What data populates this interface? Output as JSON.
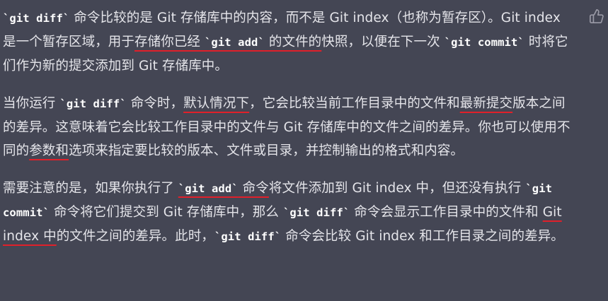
{
  "thumb_icon": "thumbs-up-icon",
  "underline_color": "#e0202a",
  "paragraphs": [
    {
      "segments": [
        {
          "text": "`git diff`",
          "style": "code"
        },
        {
          "text": " 命令比较的是 Git 存储库中的内容，而不是 Git index（也称为暂存区）。Git index 是一个暂存区域，用于",
          "style": "plain"
        },
        {
          "text": "存储你已经 ",
          "style": "underline"
        },
        {
          "text": "`git add`",
          "style": "code-underline"
        },
        {
          "text": " 的文件的",
          "style": "underline"
        },
        {
          "text": "快照，以便在下一次 ",
          "style": "plain"
        },
        {
          "text": "`git commit`",
          "style": "code"
        },
        {
          "text": " 时将它们作为新的提交添加到 Git 存储库中。",
          "style": "plain"
        }
      ]
    },
    {
      "segments": [
        {
          "text": "当你运行 ",
          "style": "plain"
        },
        {
          "text": "`git diff`",
          "style": "code"
        },
        {
          "text": " 命令时，",
          "style": "plain"
        },
        {
          "text": "默认情况下",
          "style": "underline"
        },
        {
          "text": "，它会比较当前工作目录中的文件和",
          "style": "plain"
        },
        {
          "text": "最新提交",
          "style": "underline"
        },
        {
          "text": "版本之间的差异。这意味着它会比较工作目录中的文件与 Git 存储库中的文件之间的差异。你也可以使用不同的",
          "style": "plain"
        },
        {
          "text": "参数和",
          "style": "underline"
        },
        {
          "text": "选项来指定要比较的版本、文件或目录，并控制输出的格式和内容。",
          "style": "plain"
        }
      ]
    },
    {
      "segments": [
        {
          "text": "需要注意的是，如果你执行了 ",
          "style": "plain"
        },
        {
          "text": "`git add`",
          "style": "code-underline"
        },
        {
          "text": " 命令",
          "style": "underline"
        },
        {
          "text": "将文件添加到 Git index 中，但还没有执行 ",
          "style": "plain"
        },
        {
          "text": "`git commit`",
          "style": "code"
        },
        {
          "text": " 命令将它们提交到 Git 存储库中，那么 ",
          "style": "plain"
        },
        {
          "text": "`git diff`",
          "style": "code"
        },
        {
          "text": " 命令会显示工作目录中的文件和 ",
          "style": "plain"
        },
        {
          "text": "Git index 中",
          "style": "underline"
        },
        {
          "text": "的文件之间的差异。此时，",
          "style": "plain"
        },
        {
          "text": "`git diff`",
          "style": "code"
        },
        {
          "text": " 命令会比较 Git index 和工作目录之间的差异。",
          "style": "plain"
        }
      ]
    }
  ]
}
